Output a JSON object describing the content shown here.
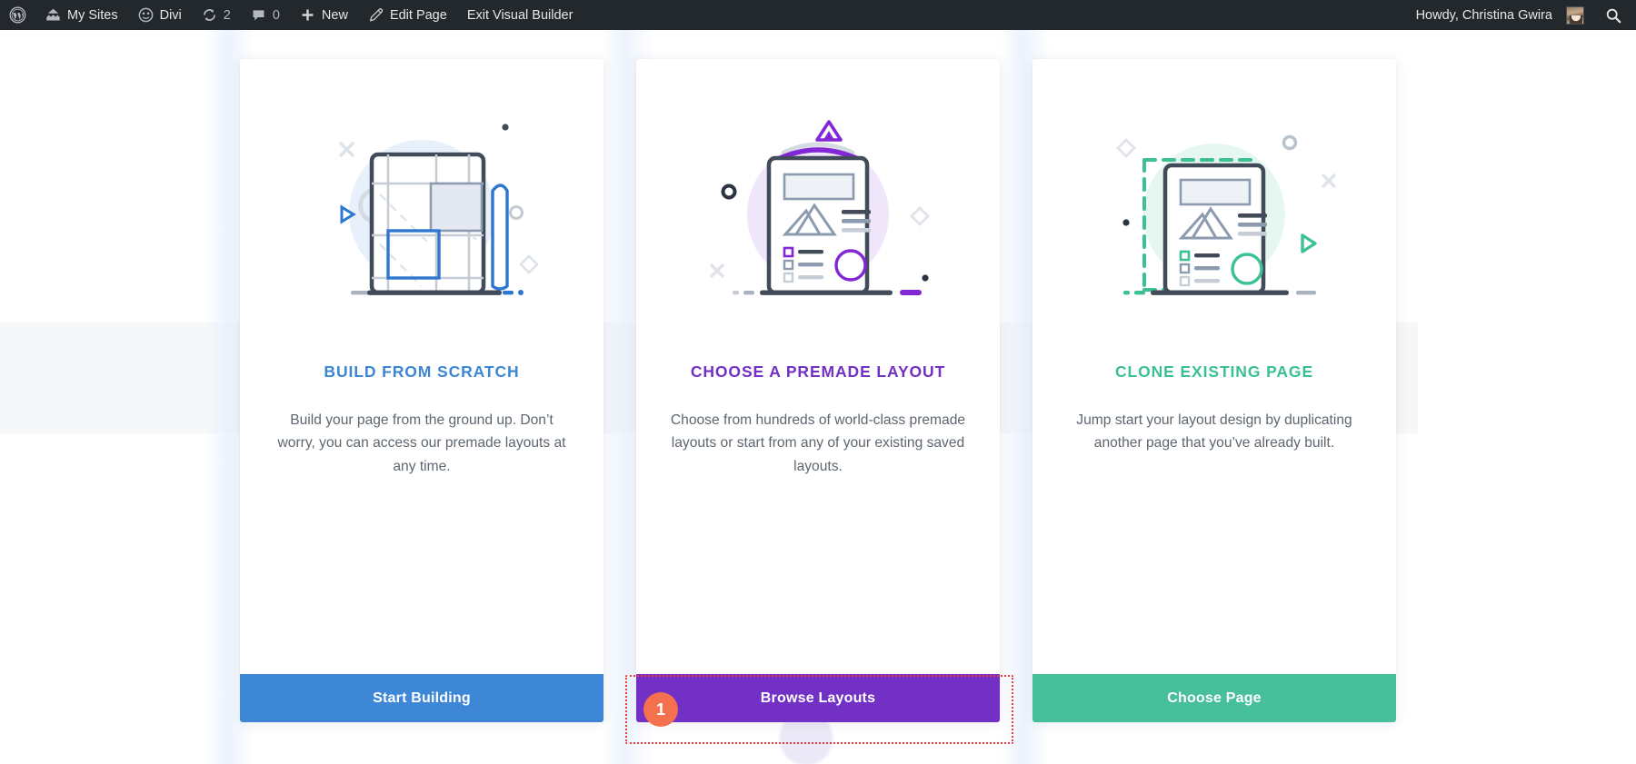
{
  "adminbar": {
    "wp_logo": "wordpress-logo-icon",
    "items": [
      {
        "id": "my-sites",
        "icon": "sites-icon",
        "label": "My Sites",
        "count": null
      },
      {
        "id": "divi",
        "icon": "divi-icon",
        "label": "Divi",
        "count": null
      },
      {
        "id": "updates",
        "icon": "update-icon",
        "label": "",
        "count": "2"
      },
      {
        "id": "comments",
        "icon": "comment-icon",
        "label": "",
        "count": "0"
      },
      {
        "id": "new",
        "icon": "plus-icon",
        "label": "New",
        "count": null
      },
      {
        "id": "edit-page",
        "icon": "pencil-icon",
        "label": "Edit Page",
        "count": null
      },
      {
        "id": "exit-vb",
        "icon": "",
        "label": "Exit Visual Builder",
        "count": null
      }
    ],
    "account": {
      "greeting": "Howdy, Christina Gwira",
      "avatar": "user-avatar",
      "search": "search-icon"
    },
    "colors": {
      "background": "#23282d",
      "text": "#e6e7e8",
      "muted": "#b4b9be"
    }
  },
  "cards": [
    {
      "id": "build-from-scratch",
      "illustration": "blueprint-wrench-pencil-illustration",
      "title": "BUILD FROM SCRATCH",
      "title_color": "#3b87d6",
      "description": "Build your page from the ground up. Don’t worry, you can access our premade layouts at any time.",
      "button_label": "Start Building",
      "button_color": "#3e87d6",
      "annotated": false
    },
    {
      "id": "choose-premade-layout",
      "illustration": "layout-page-purple-illustration",
      "title": "CHOOSE A PREMADE LAYOUT",
      "title_color": "#7230c4",
      "description": "Choose from hundreds of world-class premade layouts or start from any of your existing saved layouts.",
      "button_label": "Browse Layouts",
      "button_color": "#7230c4",
      "annotated": true
    },
    {
      "id": "clone-existing-page",
      "illustration": "layout-page-green-dashed-illustration",
      "title": "CLONE EXISTING PAGE",
      "title_color": "#3bbf96",
      "description": "Jump start your layout design by duplicating another page that you’ve already built.",
      "button_label": "Choose Page",
      "button_color": "#46bf9a",
      "annotated": false
    }
  ],
  "annotation": {
    "badge_number": "1",
    "badge_color": "#f4704f",
    "outline_color": "#ec3b3b",
    "target": "Browse Layouts"
  }
}
